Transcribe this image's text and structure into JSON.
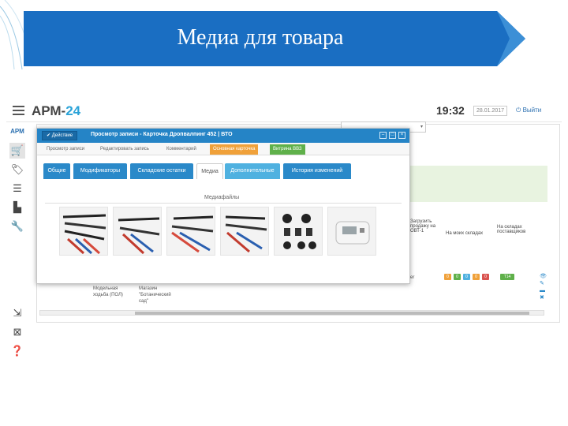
{
  "slide": {
    "title": "Медиа для товара"
  },
  "app": {
    "logo_prefix": "АРМ-",
    "logo_suffix": "24",
    "time": "19:32",
    "date": "28.01.2017",
    "logout": "Выйти",
    "sidebar_logo": "АРМ"
  },
  "modal": {
    "action_button": "Действие",
    "title": "Просмотр записи - Карточка Дропвалпинг 452 | ВТО",
    "sub_tabs": [
      "Просмотр записи",
      "Редактировать запись",
      "Комментарий",
      "Основная карточка",
      "Витрина ВВЗ"
    ],
    "tabs": [
      "Общие",
      "Модификаторы",
      "Складские остатки",
      "Медиа",
      "Дополнительные",
      "История изменений"
    ],
    "media_heading": "Медиафайлы"
  },
  "table": {
    "col_a": "Загрузить продажу на ОВТ-1",
    "col_b": "На моих складах",
    "col_c": "На складах поставщиков",
    "row_left": "Модельная ходьба (ПОЛ)",
    "row_mid": "Магазин \"Ботанический сад\"",
    "row_right": "er",
    "status_values": [
      "0",
      "0",
      "0",
      "0",
      "0"
    ],
    "status_tag": "T14"
  },
  "colors": {
    "banner": "#1a6ec2",
    "modal_header": "#2584c6",
    "tab_blue": "#2a89c9",
    "tab_orange": "#f0a13a",
    "tab_green": "#5fb04a",
    "row_green": "#e8f3e0"
  }
}
